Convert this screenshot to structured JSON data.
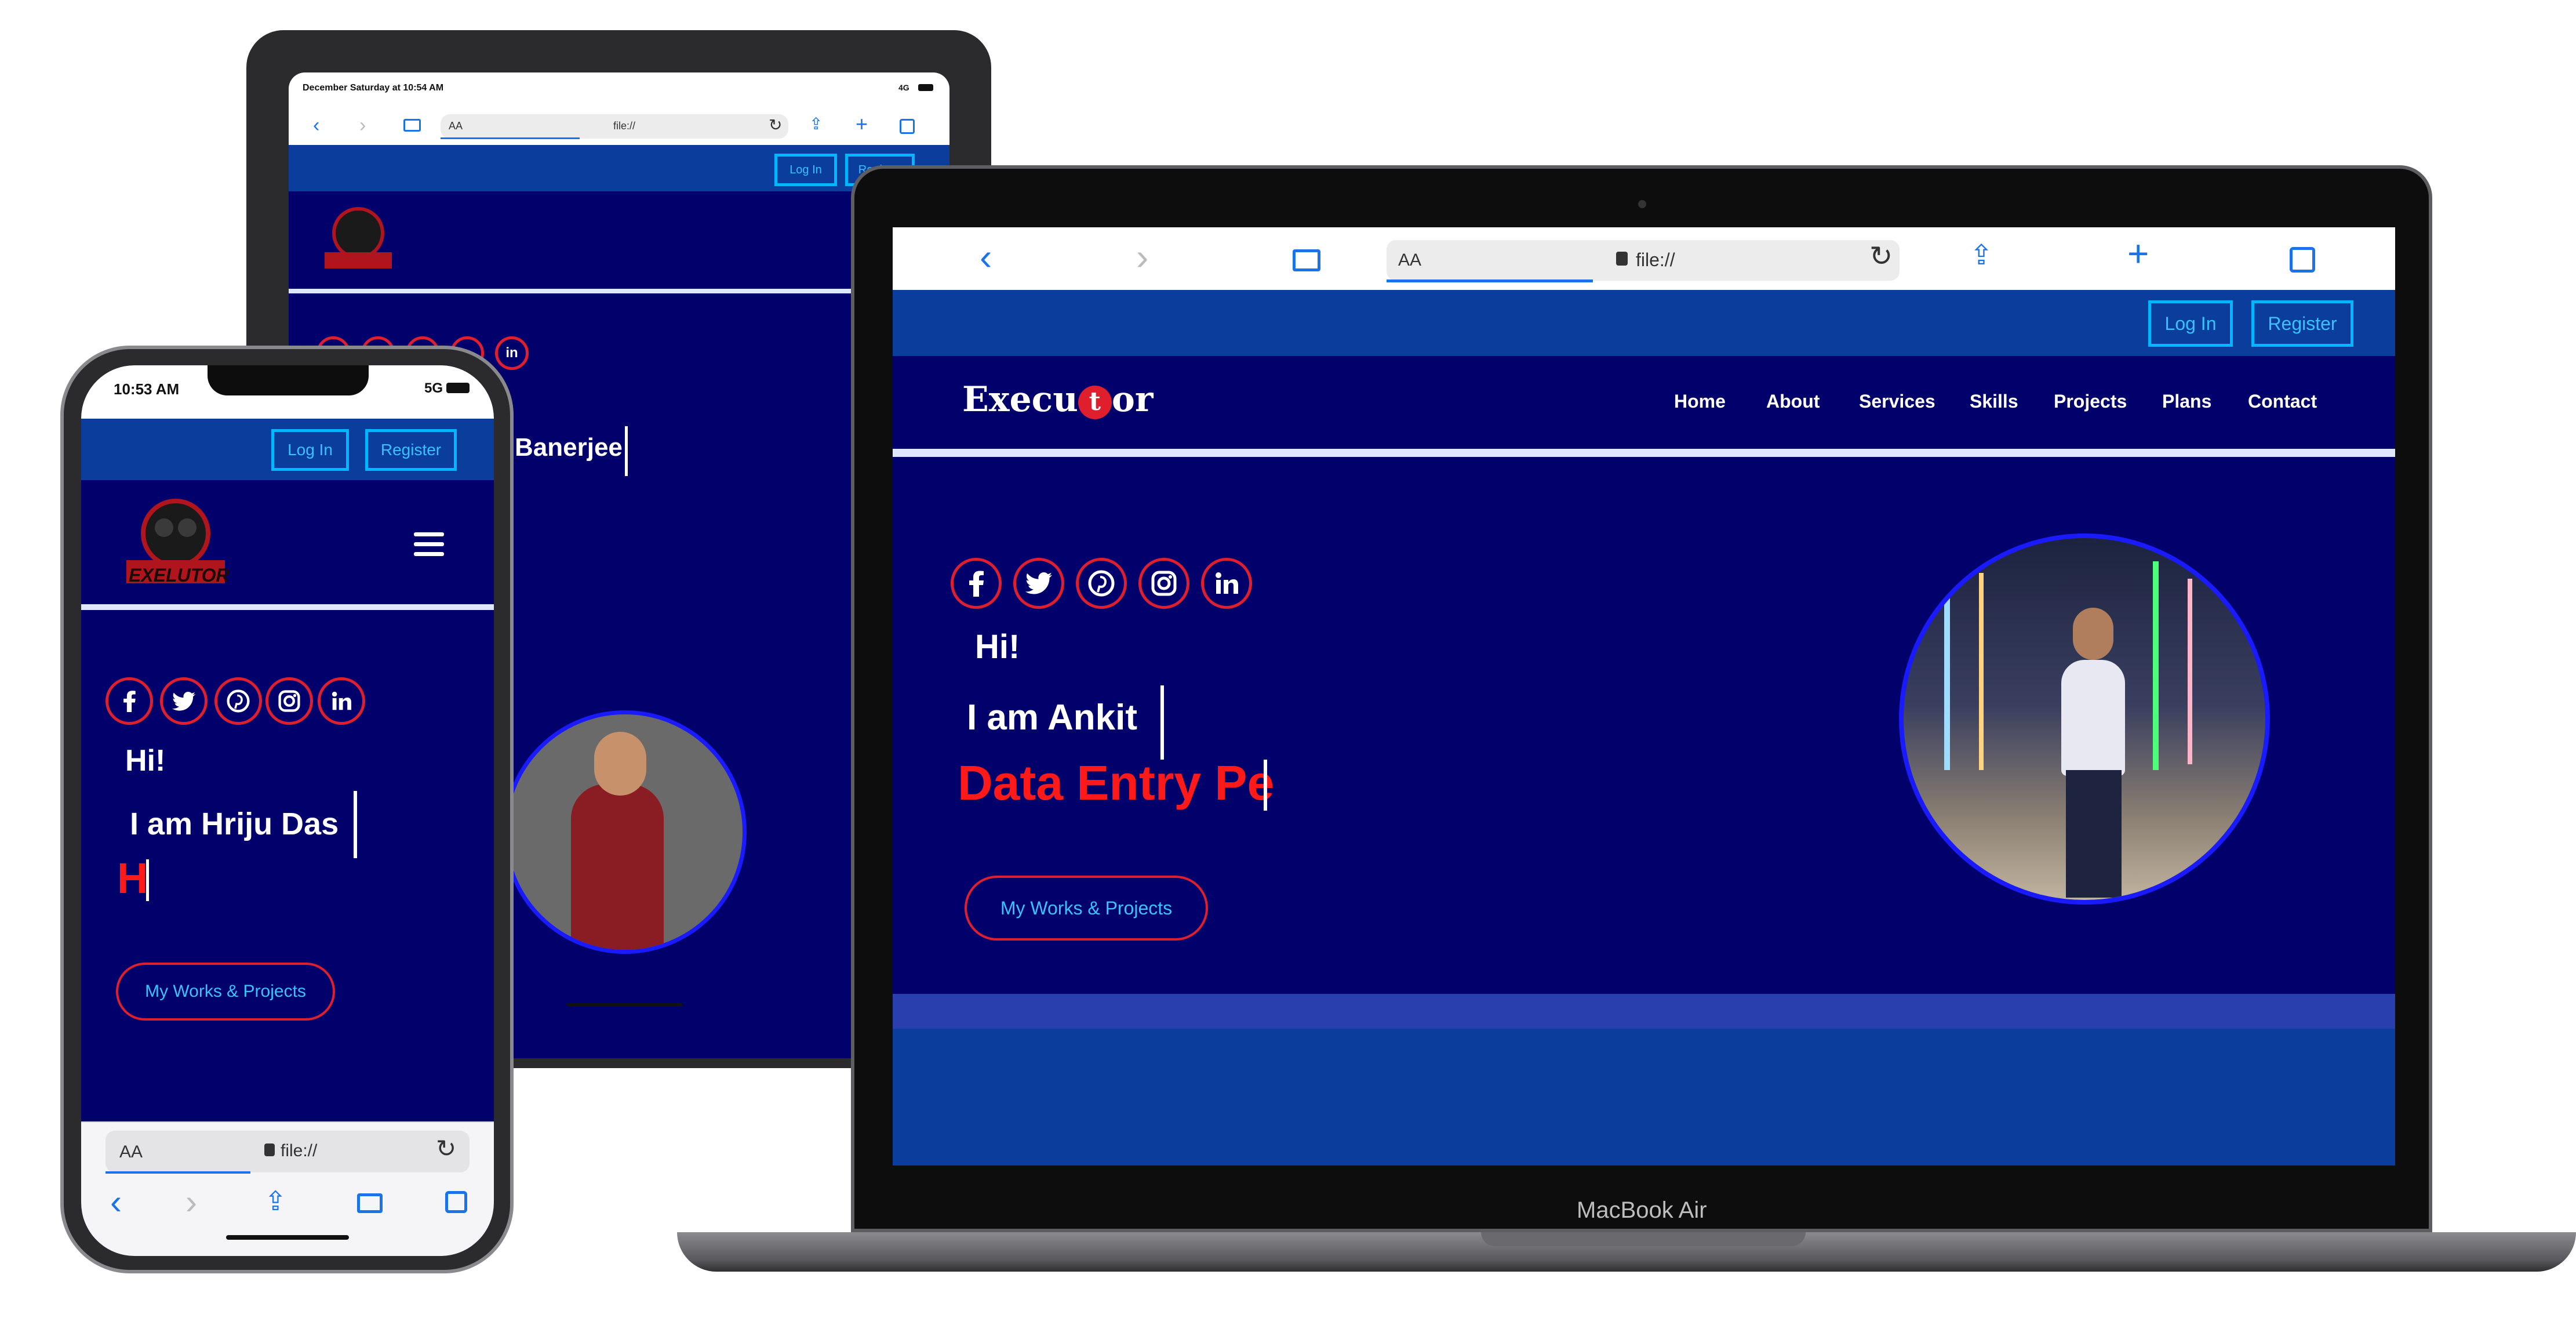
{
  "colors": {
    "nav_blue": "#0a3d9c",
    "navy": "#02006b",
    "accent_cyan": "#00b6ff",
    "accent_red": "#e01f2e",
    "white": "#ffffff"
  },
  "tablet": {
    "status_bar": {
      "time": "December Saturday at 10:54 AM",
      "signal": "4G"
    },
    "safari": {
      "aa": "AA",
      "url": "file://"
    },
    "login": "Log In",
    "register": "Register",
    "hero_name_fragment": "Banerjee"
  },
  "laptop": {
    "model": "MacBook Air",
    "safari": {
      "aa": "AA",
      "url": "file://"
    },
    "login": "Log In",
    "register": "Register",
    "brand": "Execu",
    "brand_mid": "t",
    "brand_end": "or",
    "nav": [
      "Home",
      "About",
      "Services",
      "Skills",
      "Projects",
      "Plans",
      "Contact"
    ],
    "greeting": "Hi!",
    "name": "I am Ankit",
    "typing": "Data Entry Pe",
    "cta": "My Works & Projects"
  },
  "phone": {
    "status_bar": {
      "time": "10:53 AM",
      "signal": "5G"
    },
    "login": "Log In",
    "register": "Register",
    "logo_text": "EXELUTOR",
    "greeting": "Hi!",
    "name": "I am Hriju Das",
    "typing": "H",
    "cta": "My Works & Projects",
    "safari": {
      "aa": "AA",
      "url": "file://"
    }
  },
  "icons": [
    "facebook-icon",
    "twitter-icon",
    "pinterest-icon",
    "instagram-icon",
    "linkedin-icon",
    "hamburger-menu-icon"
  ]
}
